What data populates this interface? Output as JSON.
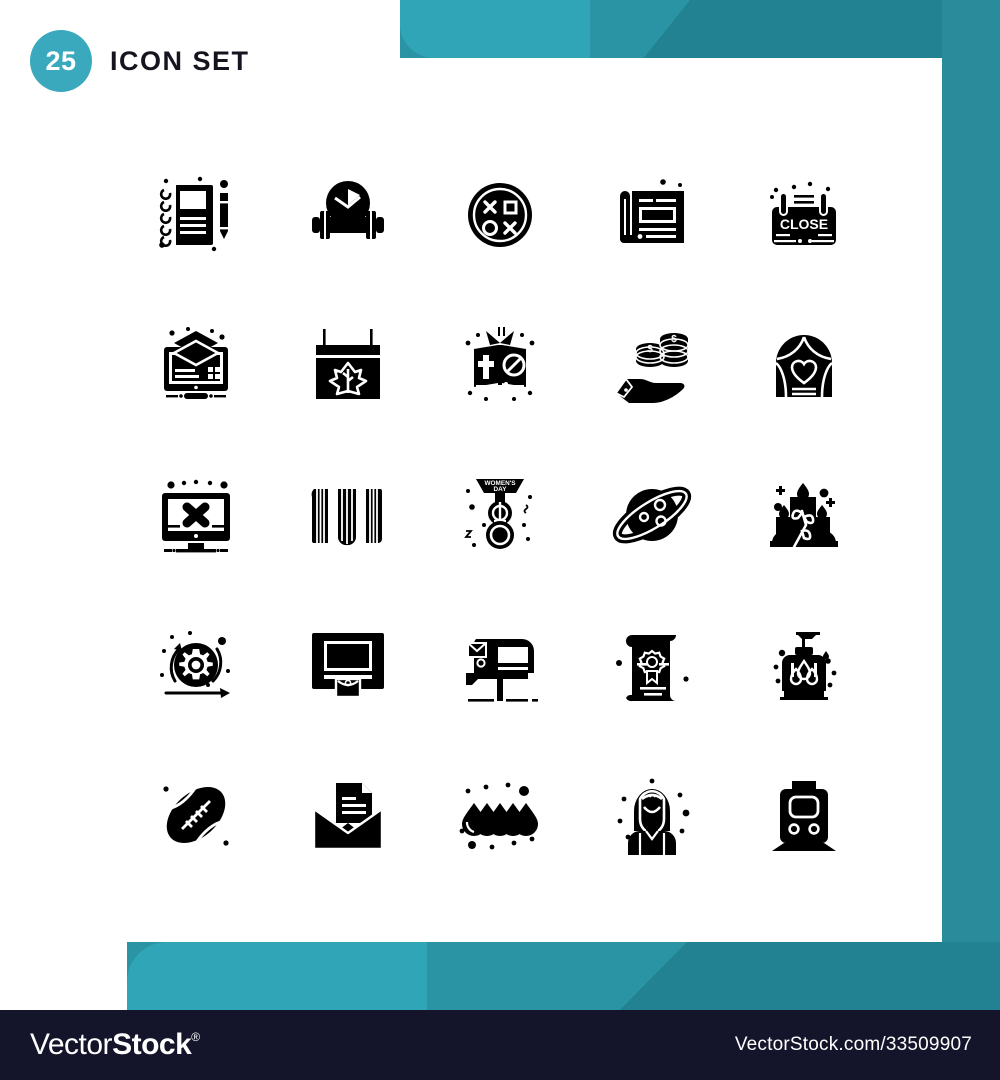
{
  "header": {
    "count": "25",
    "title": "Icon Set"
  },
  "colors": {
    "teal_light": "#31a5b8",
    "teal_mid": "#2a94a5",
    "teal_dark": "#238292",
    "badge": "#3aa9bd",
    "footer_bg": "#14142a",
    "icon": "#000000"
  },
  "footer": {
    "brand_prefix": "Vector",
    "brand_suffix": "Stock",
    "registered_mark": "®",
    "url": "VectorStock.com/33509907"
  },
  "grid": {
    "columns": 5,
    "rows": 5,
    "icons": [
      {
        "id": 1,
        "name": "notebook-pencil-icon"
      },
      {
        "id": 2,
        "name": "dumbbell-clock-icon"
      },
      {
        "id": 3,
        "name": "gamepad-buttons-icon"
      },
      {
        "id": 4,
        "name": "blueprint-icon"
      },
      {
        "id": 5,
        "name": "close-sign-icon",
        "label": "CLOSE"
      },
      {
        "id": 6,
        "name": "monitor-layers-icon"
      },
      {
        "id": 7,
        "name": "hanging-leaf-sign-icon"
      },
      {
        "id": 8,
        "name": "open-bible-icon"
      },
      {
        "id": 9,
        "name": "hand-coins-icon",
        "label": "$"
      },
      {
        "id": 10,
        "name": "arch-heart-icon"
      },
      {
        "id": 11,
        "name": "monitor-error-icon"
      },
      {
        "id": 12,
        "name": "snowboards-icon"
      },
      {
        "id": 13,
        "name": "womens-day-banner-icon",
        "label": "WOMEN'S DAY"
      },
      {
        "id": 14,
        "name": "planet-saturn-icon"
      },
      {
        "id": 15,
        "name": "candles-plant-icon"
      },
      {
        "id": 16,
        "name": "gear-refresh-icon"
      },
      {
        "id": 17,
        "name": "atm-machine-icon"
      },
      {
        "id": 18,
        "name": "mailbox-icon"
      },
      {
        "id": 19,
        "name": "certificate-icon"
      },
      {
        "id": 20,
        "name": "soap-dispenser-icon"
      },
      {
        "id": 21,
        "name": "football-icon"
      },
      {
        "id": 22,
        "name": "open-envelope-letter-icon"
      },
      {
        "id": 23,
        "name": "water-drops-icon"
      },
      {
        "id": 24,
        "name": "woman-avatar-icon"
      },
      {
        "id": 25,
        "name": "tram-train-icon"
      }
    ]
  }
}
